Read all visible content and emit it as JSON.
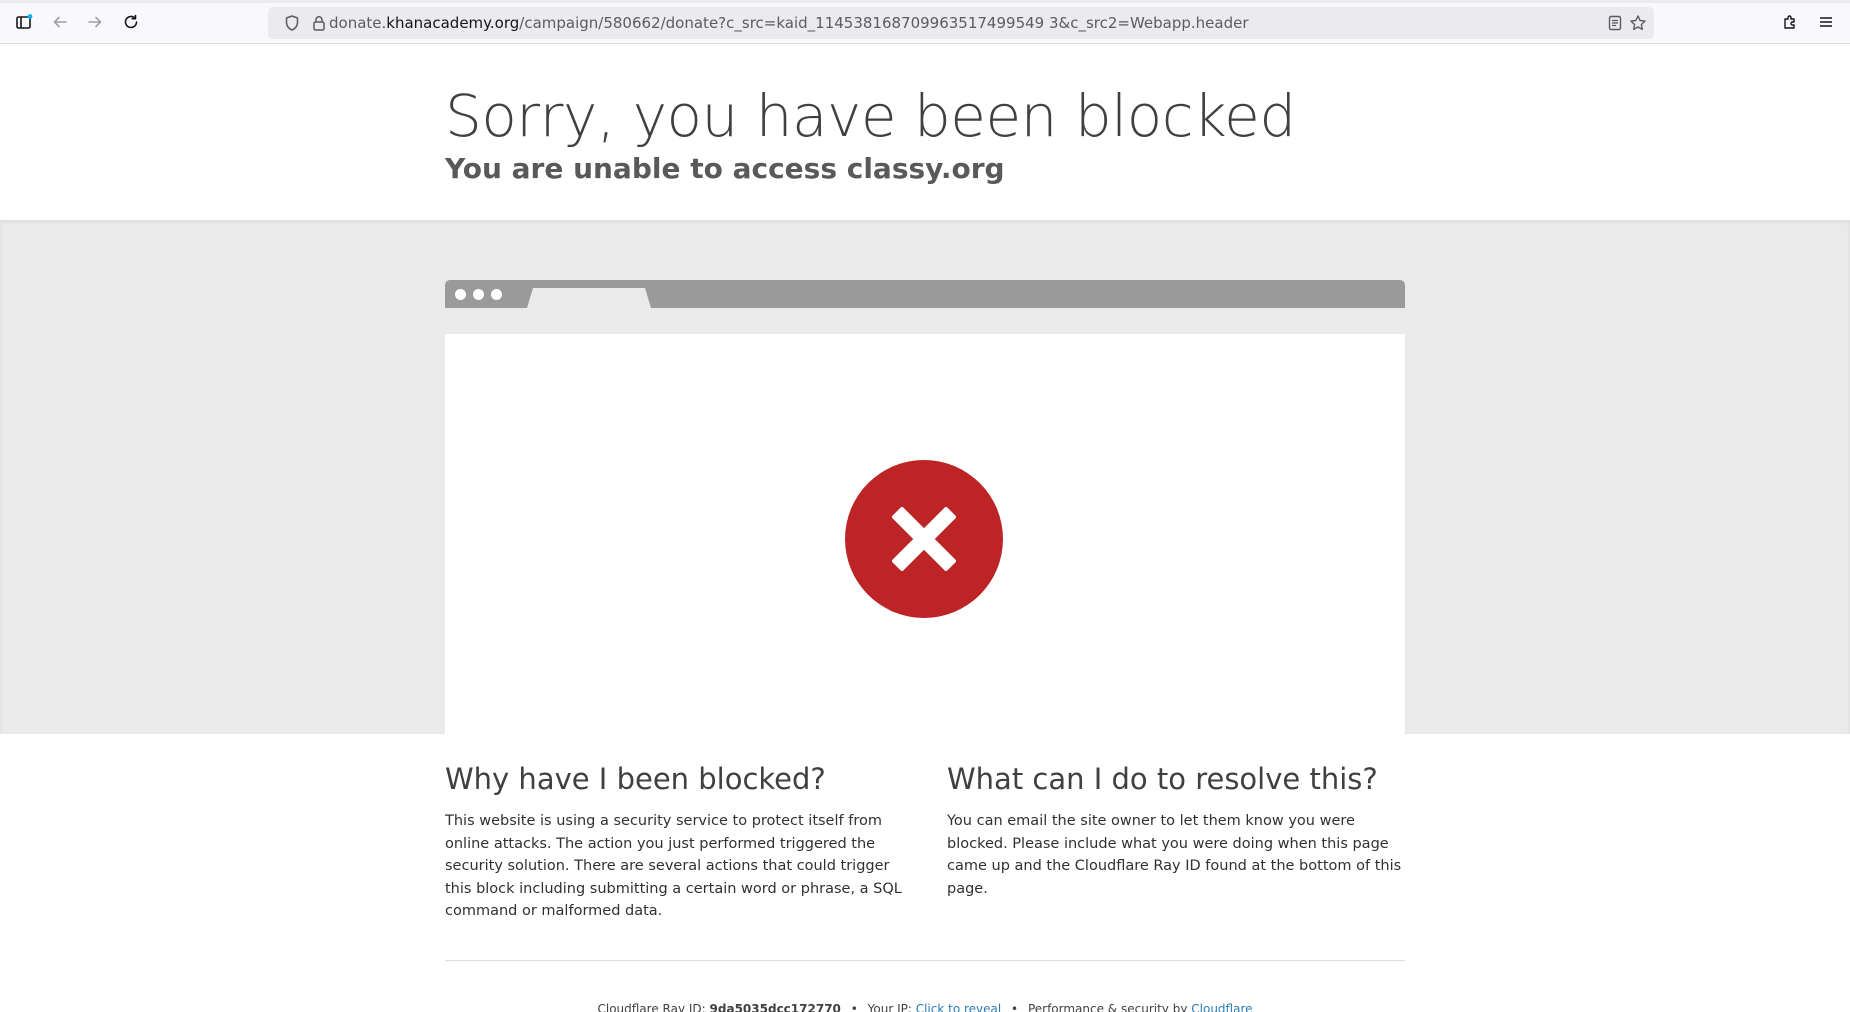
{
  "browser": {
    "url_prefix": "donate.",
    "url_host": "khanacademy.org",
    "url_path": "/campaign/580662/donate?c_src=kaid_114538168709963517499549 3&c_src2=Webapp.header"
  },
  "header": {
    "title": "Sorry, you have been blocked",
    "subtitle": "You are unable to access classy.org"
  },
  "why": {
    "heading": "Why have I been blocked?",
    "body": "This website is using a security service to protect itself from online attacks. The action you just performed triggered the security solution. There are several actions that could trigger this block including submitting a certain word or phrase, a SQL command or malformed data."
  },
  "resolve": {
    "heading": "What can I do to resolve this?",
    "body": "You can email the site owner to let them know you were blocked. Please include what you were doing when this page came up and the Cloudflare Ray ID found at the bottom of this page."
  },
  "footer": {
    "ray_label": "Cloudflare Ray ID:",
    "ray_id": "9da5035dcc172770",
    "bullet": "•",
    "ip_label": "Your IP:",
    "ip_link": "Click to reveal",
    "perf_label": "Performance & security by",
    "perf_link": "Cloudflare"
  },
  "icons": {
    "error": "error-x-icon",
    "sidebar": "sidebar-icon",
    "back": "back-arrow-icon",
    "forward": "forward-arrow-icon",
    "reload": "reload-icon",
    "tracking": "shield-icon",
    "lock": "lock-icon",
    "reader": "reader-view-icon",
    "bookmark": "star-icon",
    "extensions": "puzzle-icon",
    "menu": "hamburger-menu-icon"
  },
  "colors": {
    "error_red": "#bd2426",
    "link_blue": "#2c7cb0",
    "band_grey": "#eaeaea"
  }
}
